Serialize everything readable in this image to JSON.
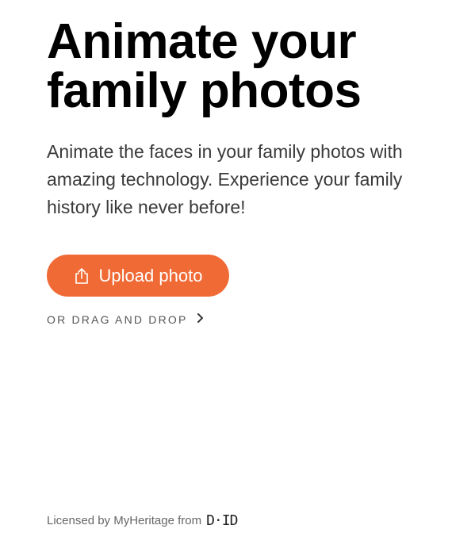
{
  "hero": {
    "headline_line1": "Animate your",
    "headline_line2": "family photos",
    "subtitle": "Animate the faces in your family photos with amazing technology. Experience your family history like never before!"
  },
  "upload": {
    "button_label": "Upload photo",
    "button_color": "#f06a35",
    "icon": "upload-icon"
  },
  "drag_drop": {
    "label": "OR DRAG AND DROP",
    "icon": "chevron-right-icon"
  },
  "footer": {
    "license_text": "Licensed by MyHeritage from",
    "logo_text": "D·ID"
  }
}
